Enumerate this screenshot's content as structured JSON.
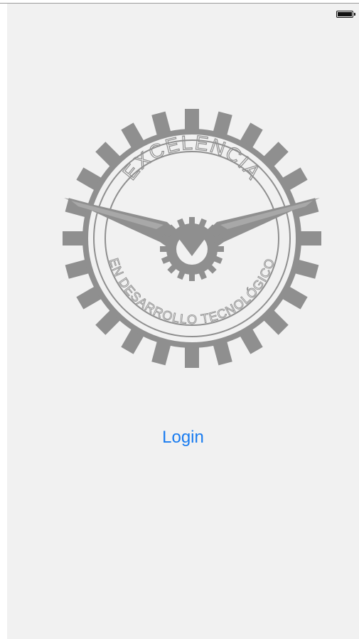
{
  "status_bar": {
    "battery_icon": "battery-full-icon",
    "battery_level": 1.0
  },
  "logo": {
    "top_text": "EXCELENCIA",
    "bottom_text": "EN DESARROLLO TECNOLÓGICO",
    "icon": "owl-gear-seal-icon",
    "color": "#8f8f8f"
  },
  "login": {
    "label": "Login",
    "color": "#1a7cf0"
  }
}
